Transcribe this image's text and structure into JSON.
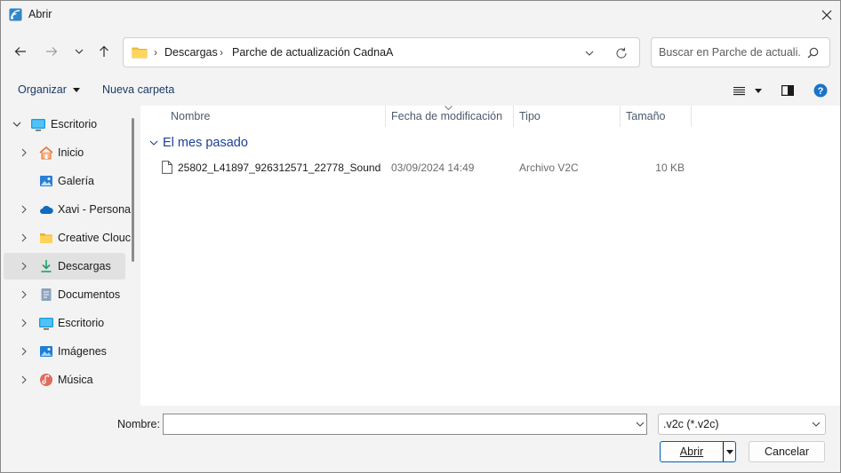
{
  "window": {
    "title": "Abrir"
  },
  "address": {
    "path": [
      "Descargas",
      "Parche de actualización CadnaA"
    ],
    "separator": "›"
  },
  "search": {
    "placeholder": "Buscar en Parche de actuali..."
  },
  "toolbar": {
    "organize_label": "Organizar",
    "new_folder_label": "Nueva carpeta"
  },
  "nav": {
    "items": [
      {
        "label": "Escritorio",
        "icon": "desktop-icon",
        "expanded": true
      },
      {
        "label": "Inicio",
        "icon": "home-icon"
      },
      {
        "label": "Galería",
        "icon": "gallery-icon"
      },
      {
        "label": "Xavi - Persona",
        "icon": "onedrive-icon"
      },
      {
        "label": "Creative Clouc",
        "icon": "folder-icon"
      },
      {
        "label": "Descargas",
        "icon": "download-icon",
        "selected": true
      },
      {
        "label": "Documentos",
        "icon": "documents-icon"
      },
      {
        "label": "Escritorio",
        "icon": "desktop-icon"
      },
      {
        "label": "Imágenes",
        "icon": "pictures-icon"
      },
      {
        "label": "Música",
        "icon": "music-icon"
      }
    ]
  },
  "columns": [
    "Nombre",
    "Fecha de modificación",
    "Tipo",
    "Tamaño"
  ],
  "group": {
    "label": "El mes pasado"
  },
  "files": [
    {
      "name": "25802_L41897_926312571_22778_Sound o...",
      "date": "03/09/2024 14:49",
      "type": "Archivo V2C",
      "size": "10 KB"
    }
  ],
  "bottom": {
    "filename_label": "Nombre:",
    "filename_value": "",
    "filetype_value": ".v2c (*.v2c)",
    "open_label": "Abrir",
    "cancel_label": "Cancelar"
  },
  "colors": {
    "accent": "#005fb8",
    "group_header": "#1c3f96",
    "selected_nav": "#e1e1e1"
  }
}
